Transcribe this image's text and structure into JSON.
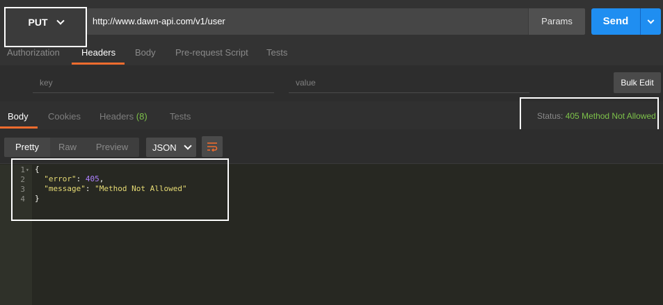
{
  "request": {
    "method": "PUT",
    "url": "http://www.dawn-api.com/v1/user",
    "params_label": "Params",
    "send_label": "Send"
  },
  "request_tabs": [
    {
      "label": "Authorization"
    },
    {
      "label": "Headers",
      "active": true
    },
    {
      "label": "Body"
    },
    {
      "label": "Pre-request Script"
    },
    {
      "label": "Tests"
    }
  ],
  "headers_editor": {
    "key_placeholder": "key",
    "value_placeholder": "value",
    "bulk_edit_label": "Bulk Edit"
  },
  "response_tabs": {
    "body": "Body",
    "cookies": "Cookies",
    "headers": "Headers",
    "headers_count": "(8)",
    "tests": "Tests"
  },
  "status": {
    "label": "Status:",
    "value": "405 Method Not Allowed",
    "color": "#7dc24a"
  },
  "view_modes": [
    "Pretty",
    "Raw",
    "Preview"
  ],
  "format": "JSON",
  "icons": {
    "wrap": "wrap-lines-icon",
    "method_dropdown": "chevron-down-icon",
    "send_dropdown": "chevron-down-icon"
  },
  "accent_color": "#ef6c2e",
  "send_color": "#1f8ef1",
  "code": {
    "line_numbers": [
      "1",
      "2",
      "3",
      "4"
    ],
    "open_brace": "{",
    "close_brace": "}",
    "error_key": "\"error\"",
    "error_value": "405",
    "message_key": "\"message\"",
    "message_value": "\"Method Not Allowed\""
  }
}
